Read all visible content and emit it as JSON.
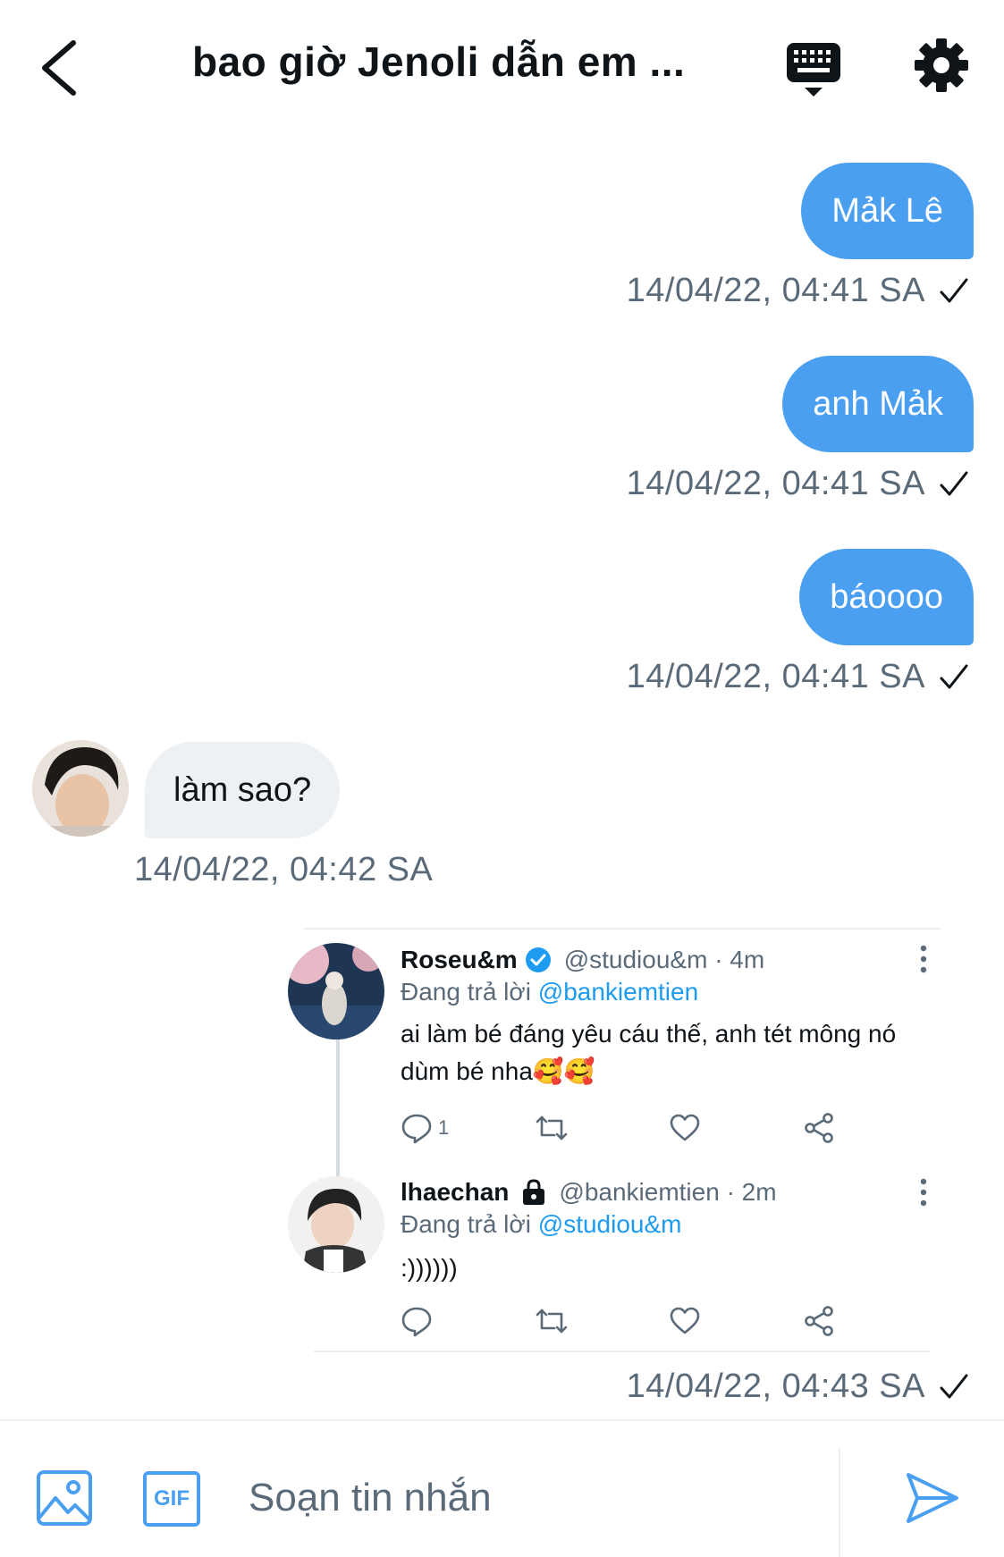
{
  "header": {
    "title": "bao giờ Jenoli dẫn em ...",
    "icons": {
      "back": "chevron-left-icon",
      "keyboard": "keyboard-icon",
      "settings": "gear-icon"
    }
  },
  "messages": [
    {
      "direction": "outgoing",
      "text": "Mảk Lê",
      "timestamp": "14/04/22, 04:41 SA",
      "status": "sent-check"
    },
    {
      "direction": "outgoing",
      "text": "anh Mảk",
      "timestamp": "14/04/22, 04:41 SA",
      "status": "sent-check"
    },
    {
      "direction": "outgoing",
      "text": "báoooo",
      "timestamp": "14/04/22, 04:41 SA",
      "status": "sent-check"
    },
    {
      "direction": "incoming",
      "text": "làm sao?",
      "timestamp": "14/04/22, 04:42 SA"
    }
  ],
  "shared_thread": {
    "tweets": [
      {
        "name": "Roseu&m",
        "verified": true,
        "handle_time": "@studiou&m · 4m",
        "replying_prefix": "Đang trả lời ",
        "replying_to": "@bankiemtien",
        "text_line1": "ai làm bé đáng yêu cáu thế, anh tét mông nó",
        "text_line2": "dùm bé nha🥰🥰",
        "reply_count": "1"
      },
      {
        "name": "lhaechan",
        "locked": true,
        "handle_time": "@bankiemtien · 2m",
        "replying_prefix": "Đang trả lời ",
        "replying_to": "@studiou&m",
        "text_line1": ":))))))",
        "reply_count": ""
      }
    ],
    "timestamp": "14/04/22, 04:43 SA",
    "status": "sent-check"
  },
  "composer": {
    "placeholder": "Soạn tin nhắn",
    "gif_label": "GIF",
    "icons": {
      "image": "image-icon",
      "gif": "gif-icon",
      "send": "send-icon"
    }
  },
  "colors": {
    "accent": "#4a9ff0",
    "link": "#1d9bf0",
    "incoming_bubble": "#eef1f4",
    "muted_text": "#5b6a78"
  }
}
